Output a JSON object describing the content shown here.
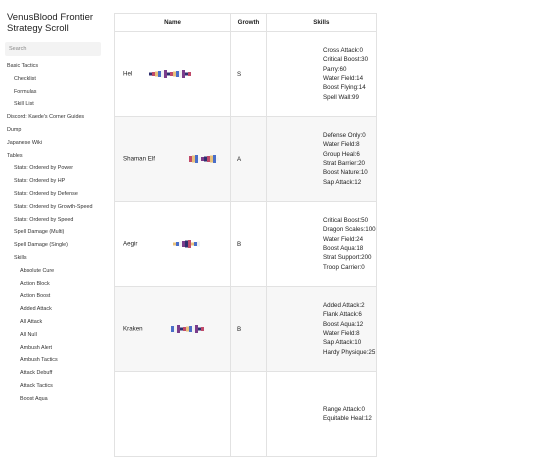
{
  "site": {
    "title": "VenusBlood Frontier Strategy Scroll",
    "search_placeholder": "Search"
  },
  "nav": [
    {
      "label": "Basic Tactics",
      "level": 0
    },
    {
      "label": "Checklist",
      "level": 1
    },
    {
      "label": "Formulas",
      "level": 1
    },
    {
      "label": "Skill List",
      "level": 1
    },
    {
      "label": "Discord: Kaede's Corner Guides",
      "level": 0
    },
    {
      "label": "Dump",
      "level": 0
    },
    {
      "label": "Japanese Wiki",
      "level": 0
    },
    {
      "label": "Tables",
      "level": 0
    },
    {
      "label": "Stats: Ordered by Power",
      "level": 1
    },
    {
      "label": "Stats: Ordered by HP",
      "level": 1
    },
    {
      "label": "Stats: Ordered by Defense",
      "level": 1
    },
    {
      "label": "Stats: Ordered by Growth-Speed",
      "level": 1
    },
    {
      "label": "Stats: Ordered by Speed",
      "level": 1
    },
    {
      "label": "Spell Damage (Multi)",
      "level": 1
    },
    {
      "label": "Spell Damage (Single)",
      "level": 1
    },
    {
      "label": "Skills",
      "level": 1
    },
    {
      "label": "Absolute Cure",
      "level": 2
    },
    {
      "label": "Action Block",
      "level": 2
    },
    {
      "label": "Action Boost",
      "level": 2
    },
    {
      "label": "Added Attack",
      "level": 2
    },
    {
      "label": "All Attack",
      "level": 2
    },
    {
      "label": "All Null",
      "level": 2
    },
    {
      "label": "Ambush Alert",
      "level": 2
    },
    {
      "label": "Ambush Tactics",
      "level": 2
    },
    {
      "label": "Attack Debuff",
      "level": 2
    },
    {
      "label": "Attack Tactics",
      "level": 2
    },
    {
      "label": "Boost Aqua",
      "level": 2
    }
  ],
  "table": {
    "headers": {
      "name": "Name",
      "growth": "Growth",
      "skills": "Skills"
    },
    "rows": [
      {
        "name": "Hel",
        "growth": "S",
        "skills": [
          "Cross Attack:0",
          "Critical Boost:30",
          "Parry:60",
          "Water Field:14",
          "Boost Flying:14",
          "Spell Wall:99"
        ]
      },
      {
        "name": "Shaman Elf",
        "growth": "A",
        "skills": [
          "Defense Only:0",
          "Water Field:8",
          "Group Heal:6",
          "Strat Barrier:20",
          "Boost Nature:10",
          "Sap Attack:12"
        ]
      },
      {
        "name": "Aegir",
        "growth": "B",
        "skills": [
          "Critical Boost:50",
          "Dragon Scales:100",
          "Water Field:24",
          "Boost Aqua:18",
          "Strat Support:200",
          "Troop Carrier:0"
        ]
      },
      {
        "name": "Kraken",
        "growth": "B",
        "skills": [
          "Added Attack:2",
          "Flank Attack:6",
          "Boost Aqua:12",
          "Water Field:8",
          "Sap Attack:10",
          "Hardy Physique:25"
        ]
      },
      {
        "name": "",
        "growth": "",
        "skills": [
          "Range Attack:0",
          "Equitable Heal:12"
        ]
      }
    ]
  },
  "sprite_colors": [
    "#2e2e6e",
    "#c04a6a",
    "#e8c07a",
    "#4a6ec8",
    "#f2f2f2",
    "#7a3c8c"
  ]
}
